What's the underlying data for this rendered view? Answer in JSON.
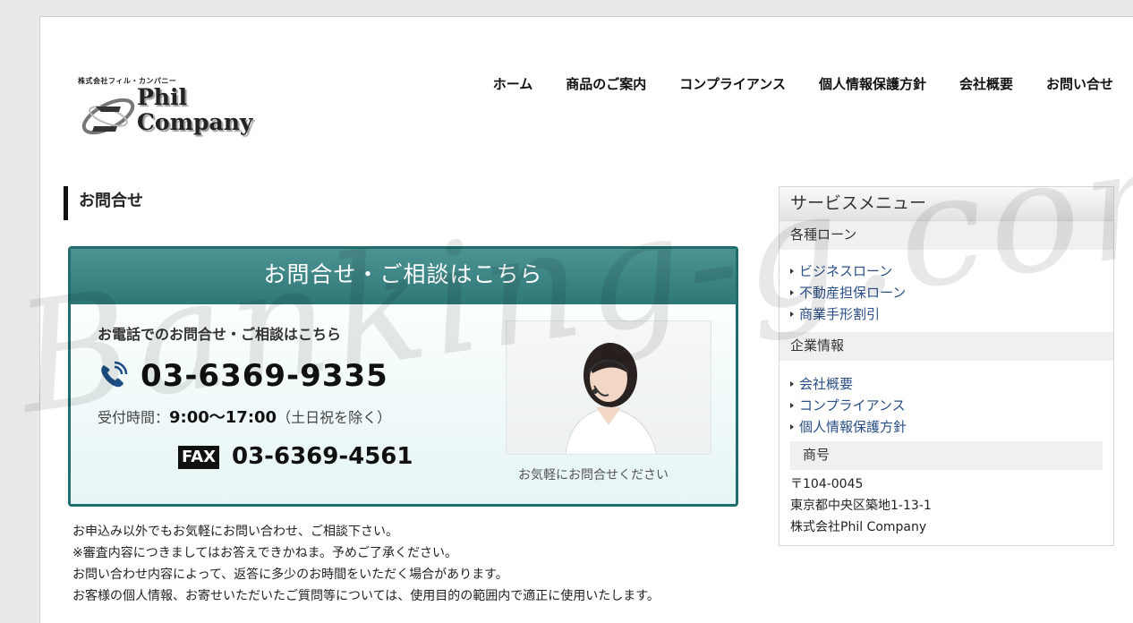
{
  "logo": {
    "small_text": "株式会社フィル・カンパニー",
    "line1": "Phil",
    "line2": "Company"
  },
  "nav": {
    "items": [
      "ホーム",
      "商品のご案内",
      "コンプライアンス",
      "個人情報保護方針",
      "会社概要",
      "お問い合せ"
    ]
  },
  "main": {
    "title": "お問合せ"
  },
  "contact": {
    "header": "お問合せ・ご相談はこちら",
    "phone_lead": "お電話でのお問合せ・ご相談はこちら",
    "phone": "03-6369-9335",
    "hours_label": "受付時間：",
    "hours_time": "9:00～17:00",
    "hours_note": "（土日祝を除く）",
    "fax_label": "FAX",
    "fax": "03-6369-4561",
    "photo_caption": "お気軽にお問合せください"
  },
  "notes": [
    "お申込み以外でもお気軽にお問い合わせ、ご相談下さい。",
    "※審査内容につきましてはお答えできかねま。予めご了承ください。",
    "お問い合わせ内容によって、返答に多少のお時間をいただく場合があります。",
    "お客様の個人情報、お寄せいただいたご質問等については、使用目的の範囲内で適正に使用いたします。"
  ],
  "sidebar": {
    "title": "サービスメニュー",
    "section1": "各種ローン",
    "loans": [
      "ビジネスローン",
      "不動産担保ローン",
      "商業手形割引"
    ],
    "section2": "企業情報",
    "company_links": [
      "会社概要",
      "コンプライアンス",
      "個人情報保護方針"
    ],
    "section3": "商号",
    "address": [
      "〒104-0045",
      "東京都中央区築地1-13-1",
      "株式会社Phil Company"
    ]
  },
  "watermark": "Banking-g.com"
}
